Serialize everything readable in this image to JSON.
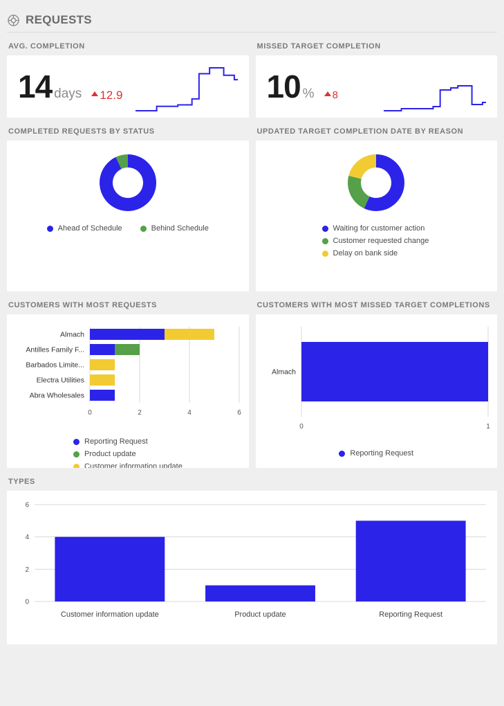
{
  "header": {
    "title": "REQUESTS",
    "icon": "target-ring-icon"
  },
  "colors": {
    "blue": "#2b23e8",
    "green": "#55a048",
    "yellow": "#f2cb32",
    "red": "#e03131",
    "background": "#efefef",
    "card": "#ffffff",
    "title_text": "#7a7a7a"
  },
  "kpis": [
    {
      "title": "AVG. COMPLETION",
      "value": "14",
      "unit": "days",
      "delta": "12.9",
      "delta_direction": "up",
      "sparkline": [
        18,
        18,
        18,
        18,
        18,
        18,
        24,
        24,
        24,
        24,
        24,
        24,
        26,
        26,
        26,
        26,
        34,
        34,
        68,
        68,
        68,
        76,
        76,
        76,
        76,
        66,
        66,
        66,
        60,
        60
      ]
    },
    {
      "title": "MISSED TARGET COMPLETION",
      "value": "10",
      "unit": "%",
      "delta": "8",
      "delta_direction": "up",
      "sparkline": [
        10,
        10,
        10,
        10,
        10,
        12,
        12,
        12,
        12,
        12,
        12,
        12,
        12,
        12,
        14,
        14,
        30,
        30,
        30,
        32,
        32,
        34,
        34,
        34,
        34,
        16,
        16,
        16,
        18,
        18
      ]
    }
  ],
  "donuts": [
    {
      "title": "COMPLETED REQUESTS BY STATUS",
      "legend_layout": "inline",
      "chart_data": {
        "type": "pie",
        "title": "Completed requests by status",
        "labels": [
          "Ahead of Schedule",
          "Behind Schedule"
        ],
        "values": [
          93,
          7
        ],
        "colors": [
          "#2b23e8",
          "#55a048"
        ]
      }
    },
    {
      "title": "UPDATED TARGET COMPLETION DATE BY REASON",
      "legend_layout": "stacked",
      "chart_data": {
        "type": "pie",
        "title": "Updated target completion date by reason",
        "labels": [
          "Waiting for customer action",
          "Customer requested change",
          "Delay on bank side"
        ],
        "values": [
          57,
          22,
          21
        ],
        "colors": [
          "#2b23e8",
          "#55a048",
          "#f2cb32"
        ]
      }
    }
  ],
  "bar_left": {
    "title": "CUSTOMERS WITH MOST REQUESTS",
    "legend": [
      {
        "label": "Reporting Request",
        "color": "#2b23e8"
      },
      {
        "label": "Product update",
        "color": "#55a048"
      },
      {
        "label": "Customer information update",
        "color": "#f2cb32"
      }
    ],
    "chart_data": {
      "type": "bar",
      "orientation": "horizontal",
      "stacked": true,
      "title": "Customers with most requests",
      "categories": [
        "Almach",
        "Antilles Family F...",
        "Barbados Limite...",
        "Electra Utilities",
        "Abra Wholesales"
      ],
      "series": [
        {
          "name": "Reporting Request",
          "color": "#2b23e8",
          "values": [
            3,
            1,
            0,
            0,
            1
          ]
        },
        {
          "name": "Product update",
          "color": "#55a048",
          "values": [
            0,
            1,
            0,
            0,
            0
          ]
        },
        {
          "name": "Customer information update",
          "color": "#f2cb32",
          "values": [
            2,
            0,
            1,
            1,
            0
          ]
        }
      ],
      "xticks": [
        "0",
        "2",
        "4",
        "6"
      ],
      "xlim": [
        0,
        6
      ],
      "grid": true
    }
  },
  "bar_right": {
    "title": "CUSTOMERS WITH MOST MISSED TARGET COMPLETIONS",
    "legend": [
      {
        "label": "Reporting Request",
        "color": "#2b23e8"
      }
    ],
    "chart_data": {
      "type": "bar",
      "orientation": "horizontal",
      "title": "Customers with most missed target completions",
      "categories": [
        "Almach"
      ],
      "series": [
        {
          "name": "Reporting Request",
          "color": "#2b23e8",
          "values": [
            1
          ]
        }
      ],
      "xticks": [
        "0",
        "1"
      ],
      "xlim": [
        0,
        1
      ],
      "grid": true
    }
  },
  "types": {
    "title": "TYPES",
    "chart_data": {
      "type": "bar",
      "orientation": "vertical",
      "title": "Types",
      "categories": [
        "Customer information update",
        "Product update",
        "Reporting Request"
      ],
      "values": [
        4,
        1,
        5
      ],
      "color": "#2b23e8",
      "yticks": [
        "0",
        "2",
        "4",
        "6"
      ],
      "ylim": [
        0,
        6
      ],
      "grid": true
    }
  }
}
